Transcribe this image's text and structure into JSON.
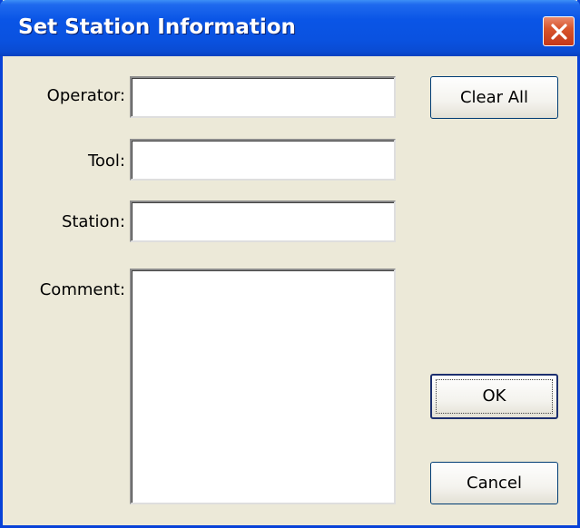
{
  "window": {
    "title": "Set Station Information",
    "close_icon": "close-icon"
  },
  "form": {
    "operator": {
      "label": "Operator:",
      "value": ""
    },
    "tool": {
      "label": "Tool:",
      "value": ""
    },
    "station": {
      "label": "Station:",
      "value": ""
    },
    "comment": {
      "label": "Comment:",
      "value": ""
    }
  },
  "buttons": {
    "clear_all": "Clear All",
    "ok": "OK",
    "cancel": "Cancel"
  },
  "colors": {
    "titlebar": "#0a55e6",
    "dialog_bg": "#ece9d8",
    "close_button": "#d8552c"
  }
}
